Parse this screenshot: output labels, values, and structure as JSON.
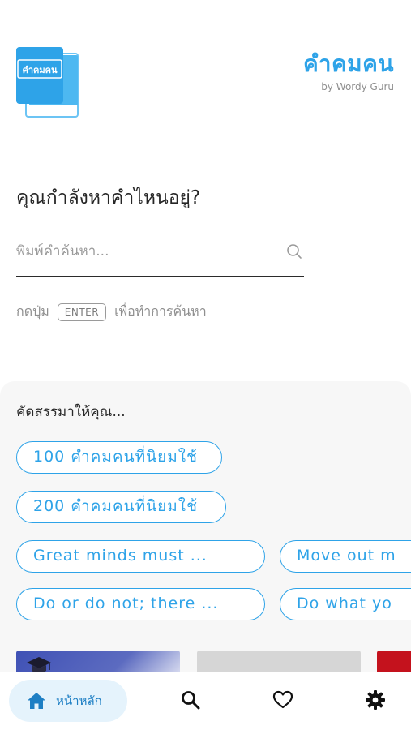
{
  "header": {
    "logo_text": "คำคมคน",
    "title": "คำคมคน",
    "subtitle": "by Wordy Guru"
  },
  "search": {
    "question": "คุณกำลังหาคำไหนอยู่?",
    "placeholder": "พิมพ์คำค้นหา...",
    "value": "",
    "hint_before": "กดปุ่ม",
    "enter_key": "ENTER",
    "hint_after": "เพื่อทำการค้นหา"
  },
  "suggestions": {
    "title": "คัดสรรมาให้คุณ...",
    "chips": [
      "100 คำคมคนที่นิยมใช้",
      "200 คำคมคนที่นิยมใช้",
      "Great minds must ...",
      "Move out m",
      "Do or do not; there ...",
      "Do what yo"
    ]
  },
  "bottom_nav": {
    "home_label": "หน้าหลัก"
  },
  "colors": {
    "accent": "#2ea3e8",
    "home_highlight": "#e5f3fc",
    "panel_bg": "#f7f7f7"
  },
  "icons": [
    "book-logo-icon",
    "search-icon",
    "graduation-cap-icon",
    "home-icon",
    "heart-icon",
    "gear-icon"
  ]
}
